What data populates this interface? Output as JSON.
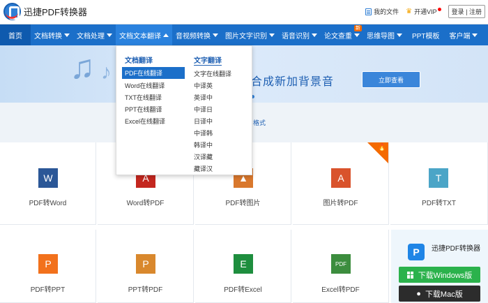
{
  "header": {
    "app_name": "迅捷PDF转换器",
    "my_files": "我的文件",
    "vip": "开通VIP",
    "login": "登录 | 注册"
  },
  "nav": {
    "items": [
      {
        "label": "首页"
      },
      {
        "label": "文档转换"
      },
      {
        "label": "文档处理"
      },
      {
        "label": "文档文本翻译"
      },
      {
        "label": "音视频转换"
      },
      {
        "label": "图片文字识别"
      },
      {
        "label": "语音识别"
      },
      {
        "label": "论文查重"
      },
      {
        "label": "思维导图"
      },
      {
        "label": "PPT模板"
      },
      {
        "label": "客户端"
      }
    ],
    "new_badge": "新"
  },
  "banner": {
    "text": "合成新加背景音",
    "button": "立即查看"
  },
  "subhead": {
    "text": "格式"
  },
  "dropdown": {
    "left_title": "文档翻译",
    "right_title": "文字翻译",
    "left_items": [
      "PDF在线翻译",
      "Word在线翻译",
      "TXT在线翻译",
      "PPT在线翻译",
      "Excel在线翻译"
    ],
    "right_items": [
      "文字在线翻译",
      "中译英",
      "英译中",
      "中译日",
      "日译中",
      "中译韩",
      "韩译中",
      "汉译藏",
      "藏译汉"
    ]
  },
  "tiles": [
    {
      "label": "PDF转Word",
      "icon": "W"
    },
    {
      "label": "Word转PDF",
      "icon": "A"
    },
    {
      "label": "PDF转图片",
      "icon": "▲"
    },
    {
      "label": "图片转PDF",
      "icon": "A"
    },
    {
      "label": "PDF转TXT",
      "icon": "T"
    },
    {
      "label": "PDF转PPT",
      "icon": "P"
    },
    {
      "label": "PPT转PDF",
      "icon": "P"
    },
    {
      "label": "PDF转Excel",
      "icon": "E"
    },
    {
      "label": "Excel转PDF",
      "icon": "PDF"
    }
  ],
  "side": {
    "title": "迅捷PDF转换器",
    "download_windows": "下载Windows版",
    "download_mac": "下载Mac版"
  },
  "colors": {
    "nav_blue": "#1b6fc9",
    "accent_orange": "#f46a00",
    "download_green": "#2bb24c"
  }
}
